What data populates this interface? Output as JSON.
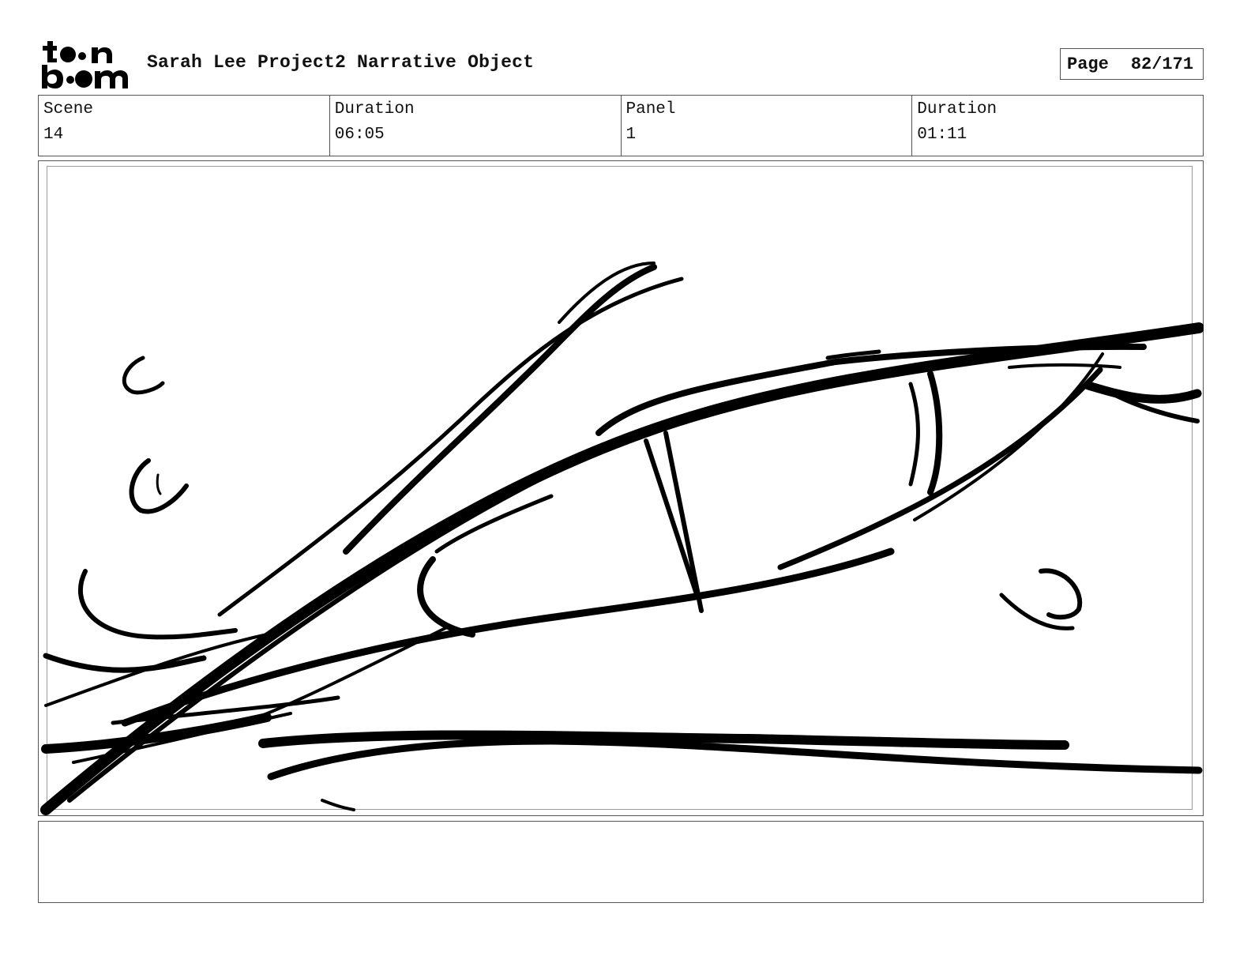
{
  "header": {
    "logo_alt": "toon boom",
    "project_title": "Sarah Lee Project2 Narrative Object",
    "page_label": "Page",
    "page_number": "82/171"
  },
  "info": {
    "scene_label": "Scene",
    "scene_value": "14",
    "scene_duration_label": "Duration",
    "scene_duration_value": "06:05",
    "panel_label": "Panel",
    "panel_value": "1",
    "panel_duration_label": "Duration",
    "panel_duration_value": "01:11"
  },
  "panel": {
    "image_icon": "storyboard-sketch-eye"
  },
  "notes": {
    "text": ""
  }
}
